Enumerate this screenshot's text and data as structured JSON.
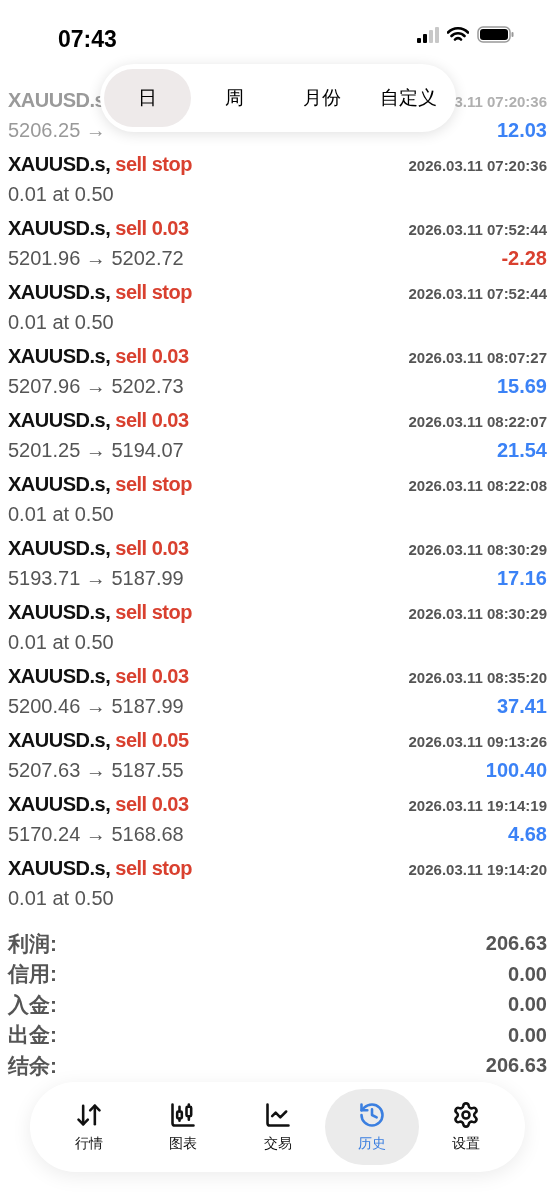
{
  "status_bar": {
    "time": "07:43"
  },
  "period_tabs": [
    {
      "label": "日",
      "selected": true
    },
    {
      "label": "周",
      "selected": false
    },
    {
      "label": "月份",
      "selected": false
    },
    {
      "label": "自定义",
      "selected": false
    }
  ],
  "trades": [
    {
      "kind": "covered",
      "symbol": "XAUUSD.s",
      "time": "3.11 07:20:36",
      "detail": "5206.25 →",
      "profit": "12.03",
      "color": "#3b82f6"
    },
    {
      "kind": "order",
      "symbol": "XAUUSD.s,",
      "side": "sell stop",
      "time": "2026.03.11 07:20:36",
      "detail": "0.01 at 0.50"
    },
    {
      "kind": "deal",
      "symbol": "XAUUSD.s,",
      "side": "sell 0.03",
      "time": "2026.03.11 07:52:44",
      "detail": "5201.96 → 5202.72",
      "profit": "-2.28",
      "color": "#d9402f"
    },
    {
      "kind": "order",
      "symbol": "XAUUSD.s,",
      "side": "sell stop",
      "time": "2026.03.11 07:52:44",
      "detail": "0.01 at 0.50"
    },
    {
      "kind": "deal",
      "symbol": "XAUUSD.s,",
      "side": "sell 0.03",
      "time": "2026.03.11 08:07:27",
      "detail": "5207.96 → 5202.73",
      "profit": "15.69",
      "color": "#3b82f6"
    },
    {
      "kind": "deal",
      "symbol": "XAUUSD.s,",
      "side": "sell 0.03",
      "time": "2026.03.11 08:22:07",
      "detail": "5201.25 → 5194.07",
      "profit": "21.54",
      "color": "#3b82f6"
    },
    {
      "kind": "order",
      "symbol": "XAUUSD.s,",
      "side": "sell stop",
      "time": "2026.03.11 08:22:08",
      "detail": "0.01 at 0.50"
    },
    {
      "kind": "deal",
      "symbol": "XAUUSD.s,",
      "side": "sell 0.03",
      "time": "2026.03.11 08:30:29",
      "detail": "5193.71 → 5187.99",
      "profit": "17.16",
      "color": "#3b82f6"
    },
    {
      "kind": "order",
      "symbol": "XAUUSD.s,",
      "side": "sell stop",
      "time": "2026.03.11 08:30:29",
      "detail": "0.01 at 0.50"
    },
    {
      "kind": "deal",
      "symbol": "XAUUSD.s,",
      "side": "sell 0.03",
      "time": "2026.03.11 08:35:20",
      "detail": "5200.46 → 5187.99",
      "profit": "37.41",
      "color": "#3b82f6"
    },
    {
      "kind": "deal",
      "symbol": "XAUUSD.s,",
      "side": "sell 0.05",
      "time": "2026.03.11 09:13:26",
      "detail": "5207.63 → 5187.55",
      "profit": "100.40",
      "color": "#3b82f6"
    },
    {
      "kind": "deal",
      "symbol": "XAUUSD.s,",
      "side": "sell 0.03",
      "time": "2026.03.11 19:14:19",
      "detail": "5170.24 → 5168.68",
      "profit": "4.68",
      "color": "#3b82f6"
    },
    {
      "kind": "order",
      "symbol": "XAUUSD.s,",
      "side": "sell stop",
      "time": "2026.03.11 19:14:20",
      "detail": "0.01 at 0.50"
    }
  ],
  "summary": [
    {
      "label": "利润:",
      "value": "206.63"
    },
    {
      "label": "信用:",
      "value": "0.00"
    },
    {
      "label": "入金:",
      "value": "0.00"
    },
    {
      "label": "出金:",
      "value": "0.00"
    },
    {
      "label": "结余:",
      "value": "206.63"
    }
  ],
  "tab_bar": [
    {
      "kind": "quotes",
      "label": "行情",
      "selected": false
    },
    {
      "kind": "chart",
      "label": "图表",
      "selected": false
    },
    {
      "kind": "trade",
      "label": "交易",
      "selected": false
    },
    {
      "kind": "history",
      "label": "历史",
      "selected": true
    },
    {
      "kind": "settings",
      "label": "设置",
      "selected": false
    }
  ]
}
